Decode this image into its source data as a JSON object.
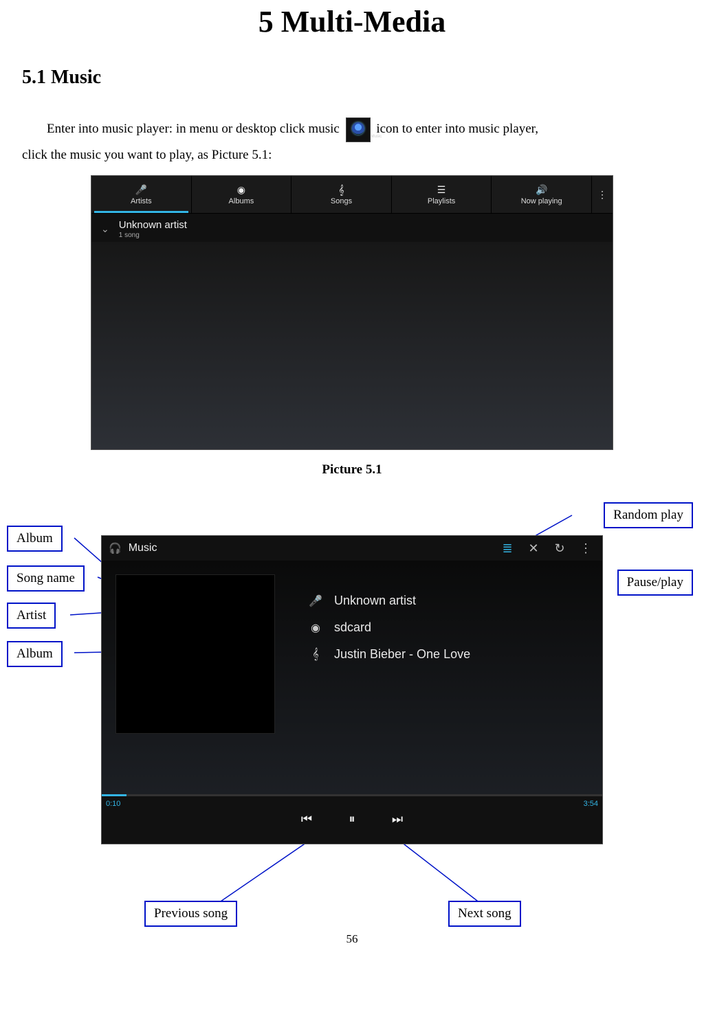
{
  "chapter_title": "5 Multi-Media",
  "section_title": "5.1 Music",
  "intro_line1a": "Enter into music player: in menu or desktop click music ",
  "intro_line1b": " icon to enter into music player,",
  "intro_line2": "click the music you want to play, as Picture 5.1:",
  "fig1": {
    "tabs": [
      "Artists",
      "Albums",
      "Songs",
      "Playlists",
      "Now playing"
    ],
    "active_tab_index": 0,
    "list_item_title": "Unknown artist",
    "list_item_sub": "1 song"
  },
  "fig1_caption": "Picture 5.1",
  "fig2": {
    "app_title": "Music",
    "artist": "Unknown artist",
    "album": "sdcard",
    "song": "Justin Bieber - One Love",
    "time_elapsed": "0:10",
    "time_total": "3:54"
  },
  "callouts": {
    "album_top": "Album",
    "song_name": "Song name",
    "artist": "Artist",
    "album_bottom": "Album",
    "random_play": "Random play",
    "pause_play": "Pause/play",
    "previous_song": "Previous song",
    "next_song": "Next song"
  },
  "page_number": "56"
}
